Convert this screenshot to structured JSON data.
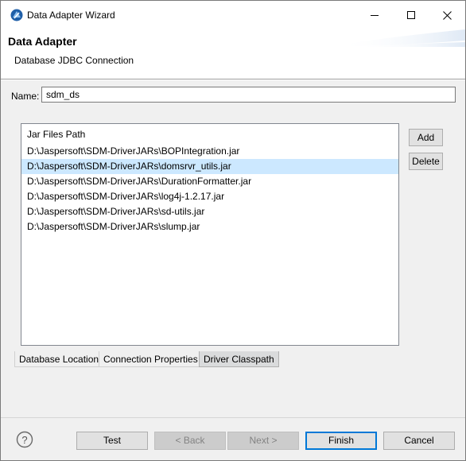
{
  "window": {
    "title": "Data Adapter Wizard",
    "controls": [
      "minimize-icon",
      "maximize-icon",
      "close-icon"
    ]
  },
  "header": {
    "title": "Data Adapter",
    "subtitle": "Database JDBC Connection"
  },
  "name_field": {
    "label": "Name:",
    "value": "sdm_ds"
  },
  "jar_panel": {
    "header": "Jar Files Path",
    "items": [
      "D:\\Jaspersoft\\SDM-DriverJARs\\BOPIntegration.jar",
      "D:\\Jaspersoft\\SDM-DriverJARs\\domsrvr_utils.jar",
      "D:\\Jaspersoft\\SDM-DriverJARs\\DurationFormatter.jar",
      "D:\\Jaspersoft\\SDM-DriverJARs\\log4j-1.2.17.jar",
      "D:\\Jaspersoft\\SDM-DriverJARs\\sd-utils.jar",
      "D:\\Jaspersoft\\SDM-DriverJARs\\slump.jar"
    ],
    "selected_index": 1,
    "add_label": "Add",
    "delete_label": "Delete"
  },
  "tabs": [
    {
      "label": "Database Location"
    },
    {
      "label": "Connection Properties"
    },
    {
      "label": "Driver Classpath"
    }
  ],
  "active_tab": 2,
  "footer": {
    "help_icon": "help-icon",
    "test_label": "Test",
    "back_label": "< Back",
    "next_label": "Next >",
    "finish_label": "Finish",
    "cancel_label": "Cancel"
  },
  "colors": {
    "selection": "#cce8ff",
    "default_button_border": "#0078d7",
    "app_icon": "#1f5fa8"
  }
}
